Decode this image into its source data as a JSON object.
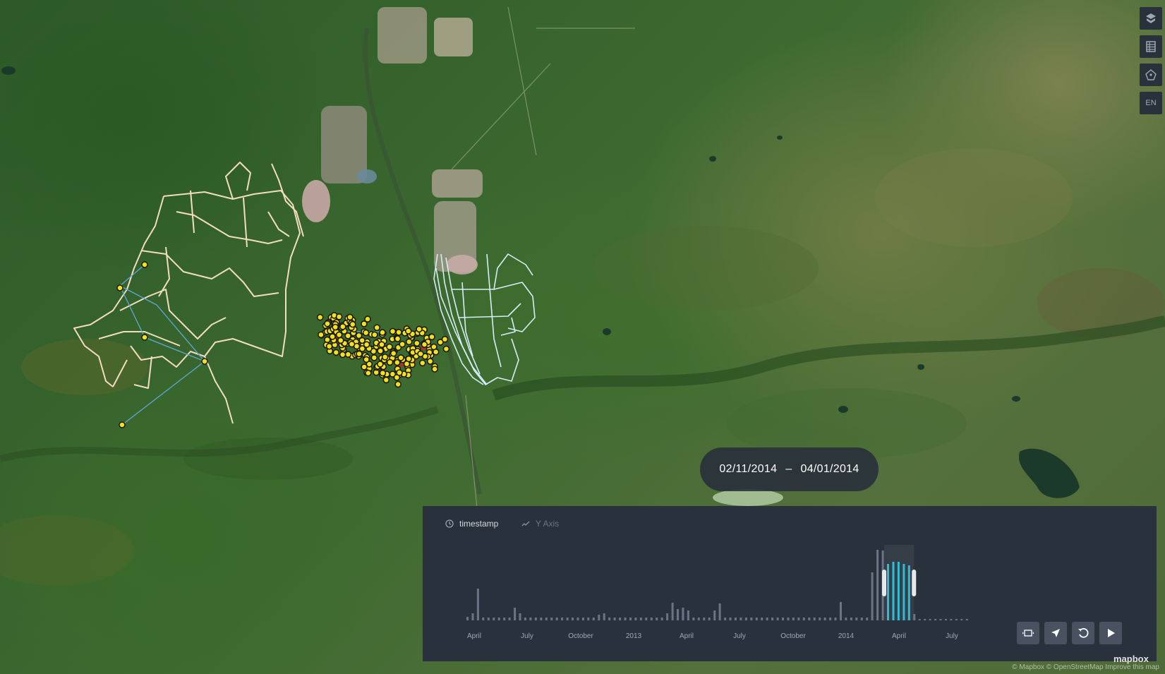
{
  "map": {
    "base": "satellite",
    "track_colors": {
      "left_track": "#f3dcc0",
      "right_track": "#d6ecf7",
      "points": "#f5e11a",
      "links": "#5fa8d6",
      "heat": "#c0262e"
    }
  },
  "side_controls": [
    {
      "id": "layers",
      "icon": "layers-icon"
    },
    {
      "id": "table",
      "icon": "table-icon"
    },
    {
      "id": "polygon",
      "icon": "polygon-draw-icon"
    },
    {
      "id": "lang",
      "label": "EN"
    }
  ],
  "time_range": {
    "start": "02/11/2014",
    "separator": "–",
    "end": "04/01/2014"
  },
  "timeline": {
    "field_tab": "timestamp",
    "y_axis_tab": "Y Axis",
    "tick_labels": [
      "April",
      "July",
      "October",
      "2013",
      "April",
      "July",
      "October",
      "2014",
      "April",
      "July"
    ],
    "bar_color": "#6a7485",
    "selected_color": "#1fbad6",
    "bars": [
      0.05,
      0.1,
      0.45,
      0.04,
      0.04,
      0.04,
      0.04,
      0.04,
      0.04,
      0.18,
      0.1,
      0.04,
      0.04,
      0.04,
      0.04,
      0.04,
      0.04,
      0.04,
      0.04,
      0.04,
      0.04,
      0.04,
      0.04,
      0.04,
      0.04,
      0.08,
      0.1,
      0.04,
      0.04,
      0.04,
      0.04,
      0.04,
      0.04,
      0.04,
      0.04,
      0.04,
      0.04,
      0.04,
      0.1,
      0.25,
      0.16,
      0.18,
      0.14,
      0.04,
      0.04,
      0.04,
      0.04,
      0.14,
      0.24,
      0.04,
      0.04,
      0.04,
      0.04,
      0.04,
      0.04,
      0.04,
      0.04,
      0.04,
      0.04,
      0.04,
      0.04,
      0.04,
      0.04,
      0.04,
      0.04,
      0.04,
      0.04,
      0.04,
      0.04,
      0.04,
      0.04,
      0.26,
      0.04,
      0.04,
      0.04,
      0.04,
      0.04,
      0.68,
      1.0,
      0.99,
      0.8,
      0.83,
      0.83,
      0.8,
      0.78,
      0.09,
      0.02,
      0.02,
      0.02,
      0.02,
      0.02,
      0.02,
      0.02,
      0.02,
      0.02,
      0.02
    ],
    "selected_from": 80,
    "selected_to": 84
  },
  "controls": [
    {
      "id": "window",
      "icon": "window-icon"
    },
    {
      "id": "speed",
      "icon": "rocket-icon"
    },
    {
      "id": "reset",
      "icon": "reset-icon"
    },
    {
      "id": "play",
      "icon": "play-icon"
    }
  ],
  "attribution": "© Mapbox © OpenStreetMap Improve this map",
  "logo": "mapbox"
}
